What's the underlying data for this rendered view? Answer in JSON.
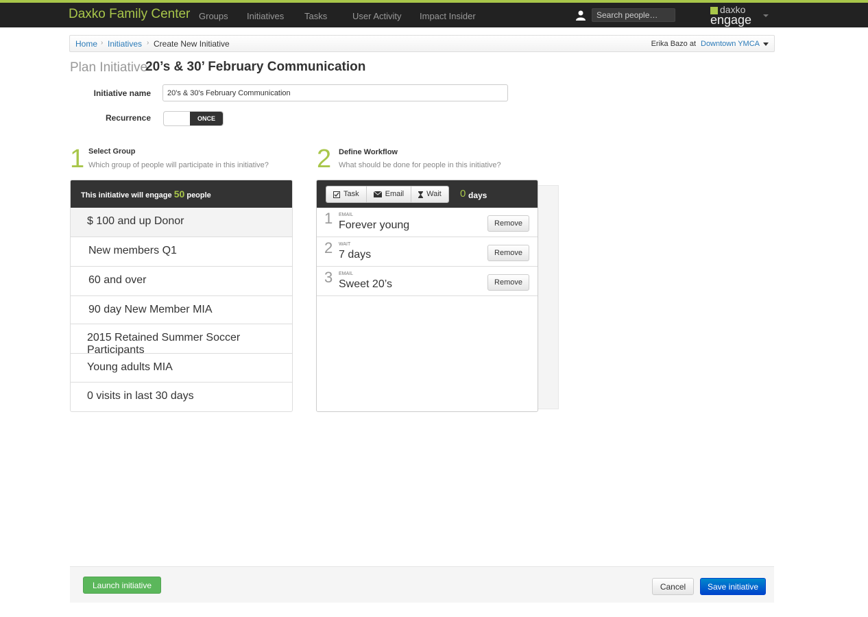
{
  "app": {
    "brand": "Daxko Family Center",
    "nav": [
      "Groups",
      "Initiatives",
      "Tasks",
      "User Activity",
      "Impact Insider"
    ],
    "search_placeholder": "Search people…",
    "logo_top": "daxko",
    "logo_bottom": "engage",
    "accent_color": "#a8c64a"
  },
  "breadcrumb": {
    "home": "Home",
    "initiatives": "Initiatives",
    "current": "Create New Initiative",
    "user": "Erika Bazo at",
    "location": "Downtown YMCA"
  },
  "title": {
    "prefix": "Plan Initiative",
    "name": "20’s & 30’ February Communication"
  },
  "form": {
    "name_label": "Initiative name",
    "name_value": "20's & 30's February Communication",
    "recurrence_label": "Recurrence",
    "recurrence_value": "ONCE"
  },
  "step1": {
    "number": "1",
    "title": "Select Group",
    "subtitle": "Which group of people will participate in this initiative?"
  },
  "step2": {
    "number": "2",
    "title": "Define Workflow",
    "subtitle": "What should be done for people in this initiative?"
  },
  "groups": {
    "header_prefix": "This initiative will engage",
    "count": "50",
    "header_suffix": "people",
    "items": [
      "$ 100 and up Donor",
      "New members Q1",
      "60 and over",
      "90 day New Member MIA",
      "2015 Retained Summer Soccer Participants",
      "Young adults MIA",
      "0 visits in last 30 days"
    ]
  },
  "workflow": {
    "buttons": {
      "task": "Task",
      "email": "Email",
      "wait": "Wait"
    },
    "days_num": "0",
    "days_label": "days",
    "remove_label": "Remove",
    "steps": [
      {
        "index": "1",
        "kind": "Email",
        "name": "Forever young"
      },
      {
        "index": "2",
        "kind": "Wait",
        "name": "7 days"
      },
      {
        "index": "3",
        "kind": "Email",
        "name": "Sweet 20’s"
      }
    ]
  },
  "footer": {
    "launch": "Launch initiative",
    "cancel": "Cancel",
    "save": "Save initiative"
  }
}
